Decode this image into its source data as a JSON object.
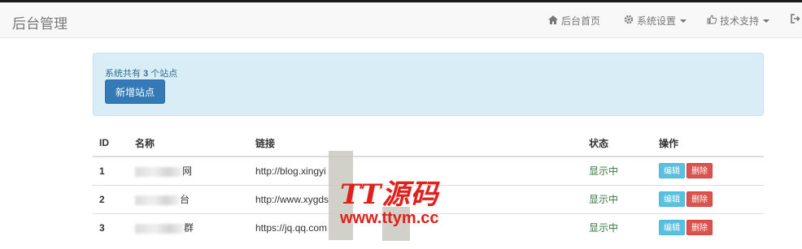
{
  "navbar": {
    "brand": "后台管理",
    "items": [
      {
        "icon": "home-icon",
        "label": "后台首页"
      },
      {
        "icon": "gear-icon",
        "label": "系统设置"
      },
      {
        "icon": "thumbs-up-icon",
        "label": "技术支持"
      }
    ]
  },
  "alert": {
    "text_prefix": "系统共有",
    "count": "3",
    "text_suffix": "个站点",
    "add_button": "新增站点"
  },
  "table": {
    "headers": [
      "ID",
      "名称",
      "链接",
      "状态",
      "操作"
    ],
    "rows": [
      {
        "id": "1",
        "name": "网",
        "url": "http://blog.xingyi",
        "status": "显示中",
        "edit": "编辑",
        "delete": "删除"
      },
      {
        "id": "2",
        "name": "台",
        "url": "http://www.xygds",
        "status": "显示中",
        "edit": "编辑",
        "delete": "删除"
      },
      {
        "id": "3",
        "name": "群",
        "url": "https://jq.qq.com",
        "status": "显示中",
        "edit": "编辑",
        "delete": "删除"
      }
    ]
  },
  "watermark": {
    "title": "TT源码",
    "url": "www.ttym.cc"
  },
  "colors": {
    "primary": "#337ab7",
    "info": "#5bc0de",
    "danger": "#d9534f",
    "success_text": "#3c763d",
    "alert_bg": "#d9edf7",
    "watermark": "#e0201a"
  }
}
